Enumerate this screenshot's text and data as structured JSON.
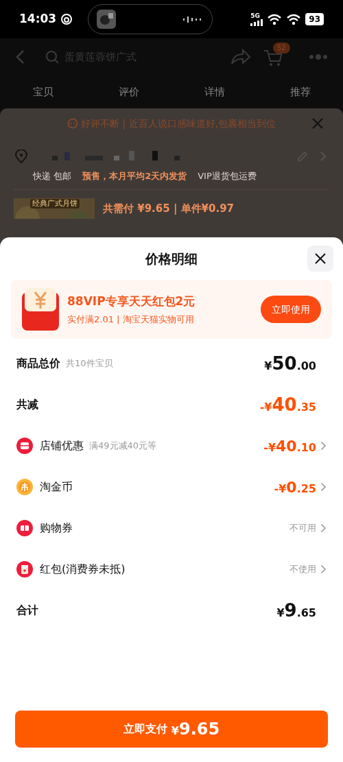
{
  "status_bar": {
    "time": "14:03",
    "network": "5G",
    "battery": "93"
  },
  "nav": {
    "search_placeholder": "蛋黄莲蓉饼广式",
    "cart_count": "52"
  },
  "tabs": [
    {
      "label": "宝贝",
      "selected": false
    },
    {
      "label": "评价",
      "selected": false
    },
    {
      "label": "详情",
      "selected": false
    },
    {
      "label": "推荐",
      "selected": false
    }
  ],
  "background_sheet": {
    "banner": "好评不断 | 近百人说口感味道好,包裹相当到位",
    "shipping": [
      {
        "text": "快递 包邮",
        "kind": "plain"
      },
      {
        "text": "预售，本月平均2天内发货",
        "kind": "highlight"
      },
      {
        "text": "VIP退货包运费",
        "kind": "vip"
      }
    ],
    "product_tag": "经典广式月饼",
    "product_price": "共需付 ¥9.65 | 单件¥0.97"
  },
  "price_sheet": {
    "title": "价格明细",
    "promo": {
      "title": "88VIP专享天天红包2元",
      "subtitle": "实付满2.01 | 淘宝天猫实物可用",
      "button": "立即使用"
    },
    "rows": [
      {
        "kind": "total",
        "label": "商品总价",
        "note": "共10件宝贝",
        "value": "¥50.00",
        "discount": false
      },
      {
        "kind": "total",
        "label": "共减",
        "value": "-¥40.35",
        "discount": true
      },
      {
        "kind": "item",
        "label": "店铺优惠",
        "note": "满49元减40元等",
        "value": "-¥40.10",
        "discount": true
      },
      {
        "kind": "item",
        "label": "淘金币",
        "value": "-¥0.25",
        "discount": true
      },
      {
        "kind": "option",
        "label": "购物券",
        "value": "不可用"
      },
      {
        "kind": "option",
        "label": "红包(消费券未抵)",
        "value": "不使用"
      },
      {
        "kind": "total",
        "label": "合计",
        "value": "¥9.65",
        "discount": false
      }
    ],
    "pay_button": {
      "label": "立即支付",
      "amount": "¥9.65"
    }
  }
}
